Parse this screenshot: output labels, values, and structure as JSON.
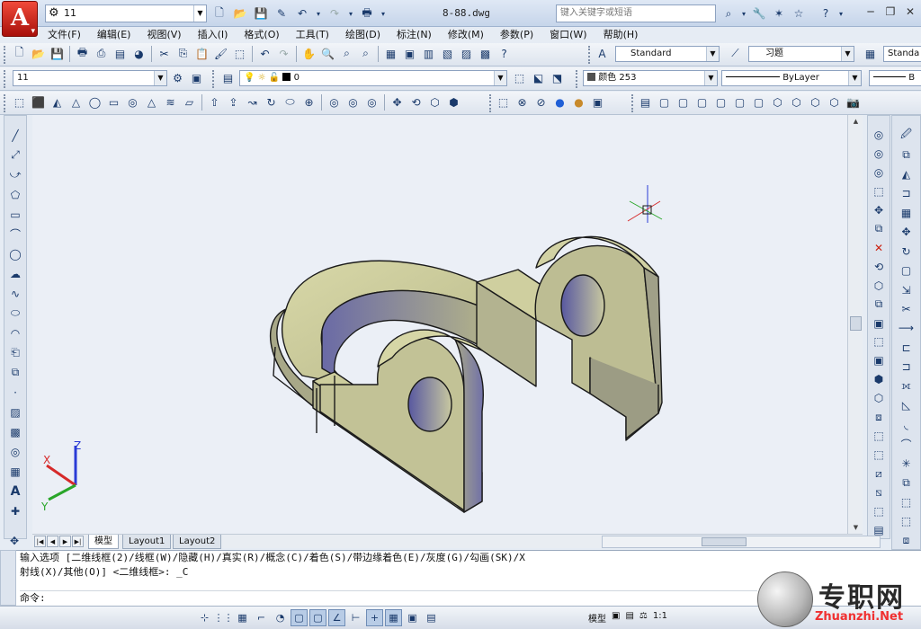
{
  "title_bar": {
    "workspace": "11",
    "document_title": "8-88.dwg",
    "search_placeholder": "键入关键字或短语",
    "icons": [
      "new-icon",
      "open-icon",
      "save-icon",
      "saveas-icon",
      "undo-icon",
      "redo-icon",
      "plot-icon",
      "binoculars-icon",
      "wrench-icon",
      "star-x-icon",
      "star-icon",
      "help-icon",
      "minimize-icon",
      "maximize-icon",
      "close-icon"
    ]
  },
  "menu": [
    "文件(F)",
    "编辑(E)",
    "视图(V)",
    "插入(I)",
    "格式(O)",
    "工具(T)",
    "绘图(D)",
    "标注(N)",
    "修改(M)",
    "参数(P)",
    "窗口(W)",
    "帮助(H)"
  ],
  "toolbar1": {
    "text_style": "Standard",
    "dim_style": "习题",
    "table_style": "Standa"
  },
  "toolbar2": {
    "workspace": "11",
    "layer": "0",
    "color": "颜色 253",
    "linetype": "ByLayer",
    "lineweight": "B"
  },
  "tabs": {
    "model": "模型",
    "layout1": "Layout1",
    "layout2": "Layout2"
  },
  "command_line": {
    "line1": "输入选项 [二维线框(2)/线框(W)/隐藏(H)/真实(R)/概念(C)/着色(S)/带边缘着色(E)/灰度(G)/勾画(SK)/X",
    "line2": "射线(X)/其他(O)] <二维线框>: _C",
    "prompt": "命令:"
  },
  "status": {
    "model_label": "模型",
    "scale": "1:1"
  },
  "ucs": {
    "x": "X",
    "y": "Y",
    "z": "Z"
  },
  "watermark": {
    "cn": "专职网",
    "en": "Zhuanzhi.Net"
  }
}
